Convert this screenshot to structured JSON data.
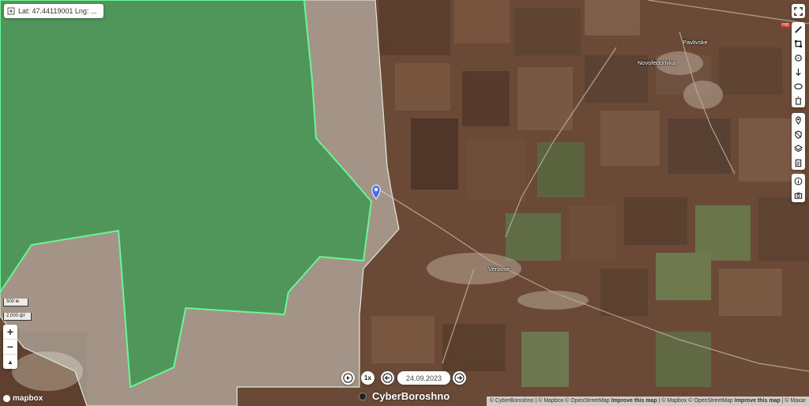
{
  "coordinates": {
    "text": "Lat: 47.44119001 Lng: ..."
  },
  "scale": {
    "metric": "500 м",
    "imperial": "2,000 фт"
  },
  "zoom": {
    "in": "+",
    "out": "−",
    "compass": "▲"
  },
  "places": {
    "pavlivske": "Pavlivske",
    "novofedorivka": "Novofedorivka",
    "verbove": "Verbove"
  },
  "road_shield": "Р85",
  "player": {
    "speed": "1x",
    "date": "24.09.2023"
  },
  "brand": "CyberBoroshno",
  "mapbox": "mapbox",
  "attribution": {
    "part1": "© CyberBoroshno | © Mapbox © OpenStreetMap",
    "improve1": "Improve this map",
    "part2": "| © Mapbox © OpenStreetMap",
    "improve2": "Improve this map",
    "part3": "| © Maxar"
  },
  "colors": {
    "controlled_fill": "#3fbf6a",
    "controlled_border": "#5cf08a",
    "contested_fill": "#e8efe6",
    "terrain": "#6b4a38",
    "marker": "#4a6cf7"
  },
  "toolbar_icons": [
    "expand-icon",
    "line-icon",
    "polygon-icon",
    "circle-icon",
    "arrow-icon",
    "ellipse-icon",
    "trash-icon",
    "pin-icon",
    "shield-icon",
    "layers-icon",
    "document-icon",
    "info-icon",
    "camera-icon"
  ]
}
